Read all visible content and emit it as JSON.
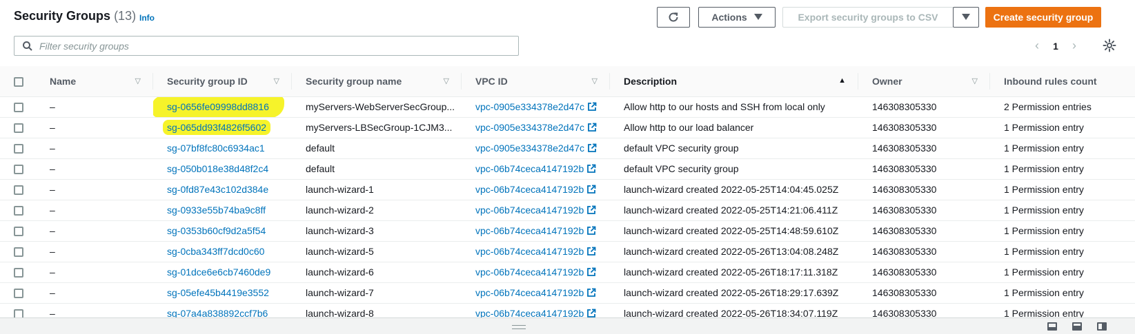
{
  "header": {
    "title": "Security Groups",
    "count": "(13)",
    "info": "Info",
    "actions_label": "Actions",
    "export_label": "Export security groups to CSV",
    "create_label": "Create security group"
  },
  "search": {
    "placeholder": "Filter security groups"
  },
  "pagination": {
    "page": "1"
  },
  "icons": {
    "refresh": "refresh-icon",
    "actions_caret": "caret-down-icon",
    "search": "search-icon",
    "settings": "gear-icon",
    "external": "external-link-icon"
  },
  "colors": {
    "accent": "#ec7211",
    "link": "#0073bb",
    "highlight": "#f6f32a"
  },
  "table": {
    "columns": [
      "Name",
      "Security group ID",
      "Security group name",
      "VPC ID",
      "Description",
      "Owner",
      "Inbound rules count"
    ],
    "rows": [
      {
        "name": "–",
        "sg_id": "sg-0656fe09998dd8816",
        "sg_name": "myServers-WebServerSecGroup...",
        "vpc_id": "vpc-0905e334378e2d47c",
        "description": "Allow http to our hosts and SSH from local only",
        "owner": "146308305330",
        "inbound": "2 Permission entries"
      },
      {
        "name": "–",
        "sg_id": "sg-065dd93f4826f5602",
        "sg_name": "myServers-LBSecGroup-1CJM3...",
        "vpc_id": "vpc-0905e334378e2d47c",
        "description": "Allow http to our load balancer",
        "owner": "146308305330",
        "inbound": "1 Permission entry"
      },
      {
        "name": "–",
        "sg_id": "sg-07bf8fc80c6934ac1",
        "sg_name": "default",
        "vpc_id": "vpc-0905e334378e2d47c",
        "description": "default VPC security group",
        "owner": "146308305330",
        "inbound": "1 Permission entry"
      },
      {
        "name": "–",
        "sg_id": "sg-050b018e38d48f2c4",
        "sg_name": "default",
        "vpc_id": "vpc-06b74ceca4147192b",
        "description": "default VPC security group",
        "owner": "146308305330",
        "inbound": "1 Permission entry"
      },
      {
        "name": "–",
        "sg_id": "sg-0fd87e43c102d384e",
        "sg_name": "launch-wizard-1",
        "vpc_id": "vpc-06b74ceca4147192b",
        "description": "launch-wizard created 2022-05-25T14:04:45.025Z",
        "owner": "146308305330",
        "inbound": "1 Permission entry"
      },
      {
        "name": "–",
        "sg_id": "sg-0933e55b74ba9c8ff",
        "sg_name": "launch-wizard-2",
        "vpc_id": "vpc-06b74ceca4147192b",
        "description": "launch-wizard created 2022-05-25T14:21:06.411Z",
        "owner": "146308305330",
        "inbound": "1 Permission entry"
      },
      {
        "name": "–",
        "sg_id": "sg-0353b60cf9d2a5f54",
        "sg_name": "launch-wizard-3",
        "vpc_id": "vpc-06b74ceca4147192b",
        "description": "launch-wizard created 2022-05-25T14:48:59.610Z",
        "owner": "146308305330",
        "inbound": "1 Permission entry"
      },
      {
        "name": "–",
        "sg_id": "sg-0cba343ff7dcd0c60",
        "sg_name": "launch-wizard-5",
        "vpc_id": "vpc-06b74ceca4147192b",
        "description": "launch-wizard created 2022-05-26T13:04:08.248Z",
        "owner": "146308305330",
        "inbound": "1 Permission entry"
      },
      {
        "name": "–",
        "sg_id": "sg-01dce6e6cb7460de9",
        "sg_name": "launch-wizard-6",
        "vpc_id": "vpc-06b74ceca4147192b",
        "description": "launch-wizard created 2022-05-26T18:17:11.318Z",
        "owner": "146308305330",
        "inbound": "1 Permission entry"
      },
      {
        "name": "–",
        "sg_id": "sg-05efe45b4419e3552",
        "sg_name": "launch-wizard-7",
        "vpc_id": "vpc-06b74ceca4147192b",
        "description": "launch-wizard created 2022-05-26T18:29:17.639Z",
        "owner": "146308305330",
        "inbound": "1 Permission entry"
      },
      {
        "name": "–",
        "sg_id": "sg-07a4a838892ccf7b6",
        "sg_name": "launch-wizard-8",
        "vpc_id": "vpc-06b74ceca4147192b",
        "description": "launch-wizard created 2022-05-26T18:34:07.119Z",
        "owner": "146308305330",
        "inbound": "1 Permission entry"
      }
    ]
  }
}
